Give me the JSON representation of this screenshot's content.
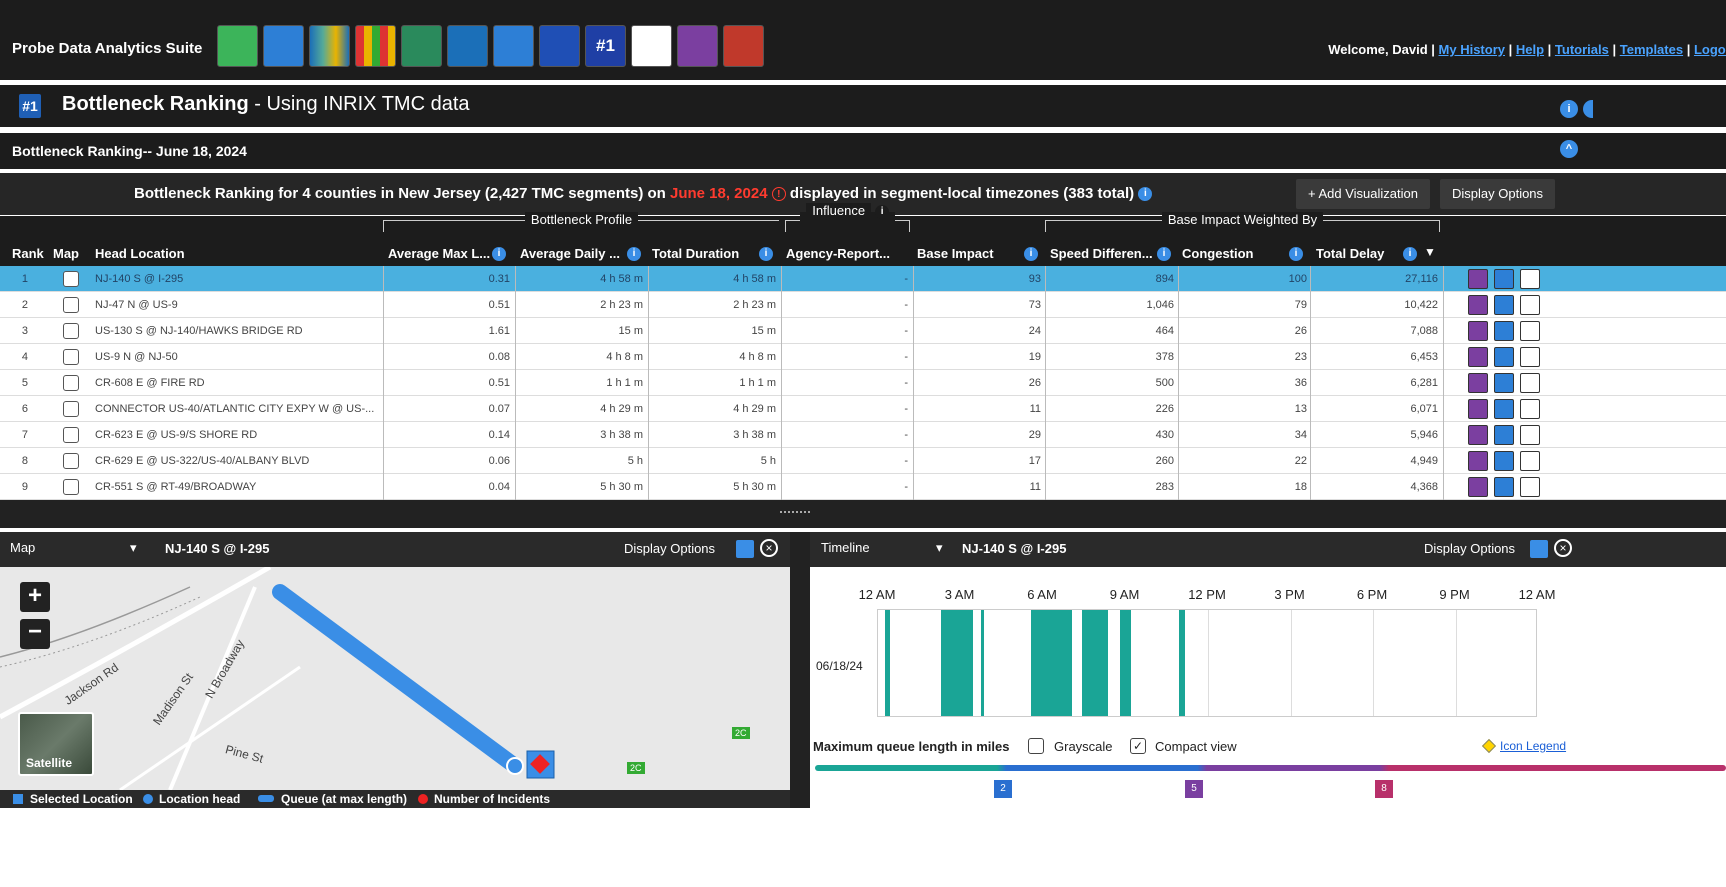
{
  "app": {
    "title": "Probe Data Analytics Suite",
    "welcome_prefix": "Welcome, David | ",
    "links": [
      "My History",
      "Help",
      "Tutorials",
      "Templates",
      "Logout"
    ]
  },
  "colors": {
    "accent": "#3a8ee6",
    "date": "#ff3b2f",
    "selected_row": "#4ab0df",
    "teal": "#1aa596"
  },
  "header": {
    "badge": "#1",
    "title_bold": "Bottleneck Ranking",
    "title_rest": " - Using INRIX TMC data"
  },
  "subtitle": "Bottleneck Ranking-- June 18, 2024",
  "summary": {
    "prefix": "Bottleneck Ranking for 4 counties in New Jersey (2,427 TMC segments) on ",
    "date": "June 18, 2024",
    "suffix": " displayed in segment-local timezones (383 total)"
  },
  "buttons": {
    "add_vis": "+ Add Visualization",
    "display_options": "Display Options"
  },
  "groups": {
    "profile": "Bottleneck Profile",
    "influence": "Influence",
    "weighted": "Base Impact Weighted By"
  },
  "columns": [
    "Rank",
    "Map",
    "Head Location",
    "Average Max L...",
    "Average Daily ...",
    "Total Duration",
    "Agency-Report...",
    "Base Impact",
    "Speed Differen...",
    "Congestion",
    "Total Delay"
  ],
  "rows": [
    {
      "rank": "1",
      "loc": "NJ-140 S @ I-295",
      "aml": "0.31",
      "adaily": "4 h 58 m",
      "dur": "4 h 58 m",
      "agency": "-",
      "base": "93",
      "speed": "894",
      "cong": "100",
      "delay": "27,116"
    },
    {
      "rank": "2",
      "loc": "NJ-47 N @ US-9",
      "aml": "0.51",
      "adaily": "2 h 23 m",
      "dur": "2 h 23 m",
      "agency": "-",
      "base": "73",
      "speed": "1,046",
      "cong": "79",
      "delay": "10,422"
    },
    {
      "rank": "3",
      "loc": "US-130 S @ NJ-140/HAWKS BRIDGE RD",
      "aml": "1.61",
      "adaily": "15 m",
      "dur": "15 m",
      "agency": "-",
      "base": "24",
      "speed": "464",
      "cong": "26",
      "delay": "7,088"
    },
    {
      "rank": "4",
      "loc": "US-9 N @ NJ-50",
      "aml": "0.08",
      "adaily": "4 h 8 m",
      "dur": "4 h 8 m",
      "agency": "-",
      "base": "19",
      "speed": "378",
      "cong": "23",
      "delay": "6,453"
    },
    {
      "rank": "5",
      "loc": "CR-608 E @ FIRE RD",
      "aml": "0.51",
      "adaily": "1 h 1 m",
      "dur": "1 h 1 m",
      "agency": "-",
      "base": "26",
      "speed": "500",
      "cong": "36",
      "delay": "6,281"
    },
    {
      "rank": "6",
      "loc": "CONNECTOR US-40/ATLANTIC CITY EXPY W @ US-...",
      "aml": "0.07",
      "adaily": "4 h 29 m",
      "dur": "4 h 29 m",
      "agency": "-",
      "base": "11",
      "speed": "226",
      "cong": "13",
      "delay": "6,071"
    },
    {
      "rank": "7",
      "loc": "CR-623 E @ US-9/S SHORE RD",
      "aml": "0.14",
      "adaily": "3 h 38 m",
      "dur": "3 h 38 m",
      "agency": "-",
      "base": "29",
      "speed": "430",
      "cong": "34",
      "delay": "5,946"
    },
    {
      "rank": "8",
      "loc": "CR-629 E @ US-322/US-40/ALBANY BLVD",
      "aml": "0.06",
      "adaily": "5 h",
      "dur": "5 h",
      "agency": "-",
      "base": "17",
      "speed": "260",
      "cong": "22",
      "delay": "4,949"
    },
    {
      "rank": "9",
      "loc": "CR-551 S @ RT-49/BROADWAY",
      "aml": "0.04",
      "adaily": "5 h 30 m",
      "dur": "5 h 30 m",
      "agency": "-",
      "base": "11",
      "speed": "283",
      "cong": "18",
      "delay": "4,368"
    }
  ],
  "map_panel": {
    "type": "Map",
    "location": "NJ-140 S @ I-295",
    "display_options": "Display Options",
    "satellite": "Satellite",
    "streets": [
      "Jackson Rd",
      "Madison St",
      "N Broadway",
      "Pine St"
    ],
    "route_badges": [
      "2C",
      "2C"
    ]
  },
  "legend": [
    "Selected Location",
    "Location head",
    "Queue (at max length)",
    "Number of Incidents"
  ],
  "timeline_panel": {
    "type": "Timeline",
    "location": "NJ-140 S @ I-295",
    "display_options": "Display Options",
    "hours": [
      "12 AM",
      "3 AM",
      "6 AM",
      "9 AM",
      "12 PM",
      "3 PM",
      "6 PM",
      "9 PM",
      "12 AM"
    ],
    "date": "06/18/24",
    "queue_label": "Maximum queue length in miles",
    "grayscale": "Grayscale",
    "compact": "Compact view",
    "icon_legend": "Icon Legend",
    "scale_marks": [
      "2",
      "5",
      "8"
    ]
  },
  "timeline_bars": [
    [
      0.25,
      0.45
    ],
    [
      2.3,
      3.45
    ],
    [
      3.75,
      3.85
    ],
    [
      5.55,
      7.05
    ],
    [
      7.4,
      8.35
    ],
    [
      8.8,
      9.2
    ],
    [
      10.95,
      11.15
    ]
  ]
}
